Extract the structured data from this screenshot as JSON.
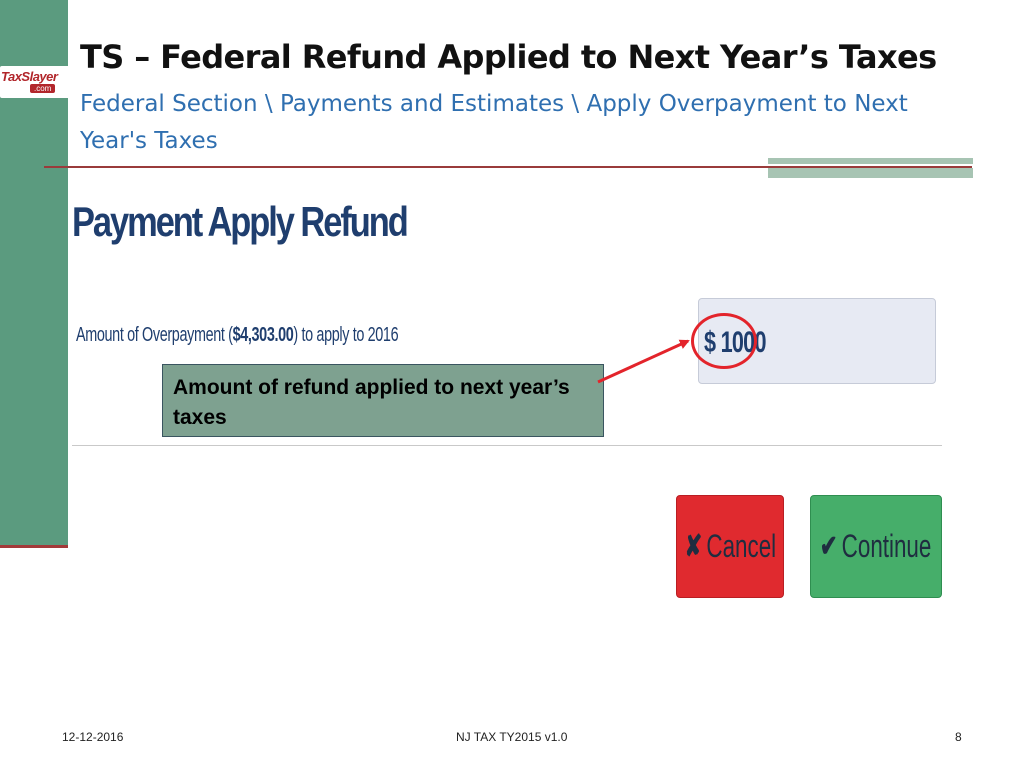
{
  "brand": {
    "logo_text": "TaxSlayer",
    "logo_sub": ".com"
  },
  "slide": {
    "title": "TS – Federal Refund Applied to Next Year’s Taxes",
    "subtitle": "Federal Section \\ Payments and Estimates \\ Apply Overpayment to Next Year's Taxes"
  },
  "form": {
    "heading": "Payment Apply Refund",
    "overpayment_prefix": "Amount of Overpayment (",
    "overpayment_amount": "$4,303.00",
    "overpayment_suffix": ") to apply to 2016",
    "amount_value": "$ 1000"
  },
  "callout": {
    "text": "Amount of refund applied to next year’s taxes"
  },
  "buttons": {
    "cancel_icon": "✘",
    "cancel_label": "Cancel",
    "continue_icon": "✔",
    "continue_label": "Continue"
  },
  "footer": {
    "date": "12-12-2016",
    "center": "NJ TAX TY2015 v1.0",
    "page": "8"
  },
  "colors": {
    "sidebar": "#5b9b7f",
    "title_rule": "#9a3b3b",
    "subtitle": "#2f6fb0",
    "callout_bg": "#7ea190",
    "highlight": "#e3242b",
    "cancel": "#e02a2f",
    "continue": "#46ae6a"
  }
}
